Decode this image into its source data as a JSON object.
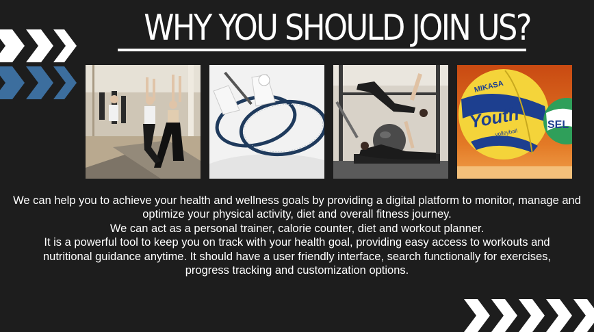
{
  "heading": {
    "title": "WHY YOU SHOULD JOIN US?"
  },
  "images": [
    {
      "icon": "yoga-class-photo"
    },
    {
      "icon": "badminton-rackets-photo"
    },
    {
      "icon": "pilates-photo"
    },
    {
      "icon": "volleyballs-photo"
    }
  ],
  "ball_labels": {
    "brand": "MIKASA",
    "word": "Youth",
    "sub": "volleyball",
    "second_ball": "SEL"
  },
  "body": {
    "paragraph1": "We can help you to achieve your health and wellness goals by providing a digital platform to monitor, manage and optimize your physical activity, diet and overall fitness journey.",
    "paragraph2": "We can act as a personal trainer, calorie counter, diet and workout planner.",
    "paragraph3": "It is a powerful tool to keep you on track with your health goal, providing easy access to workouts and nutritional guidance anytime. It should have a user friendly interface, search functionally for exercises, progress tracking and customization options."
  },
  "colors": {
    "background": "#1d1d1d",
    "text": "#ffffff",
    "chevron_white": "#ffffff",
    "chevron_blue": "#3c6e9e"
  }
}
